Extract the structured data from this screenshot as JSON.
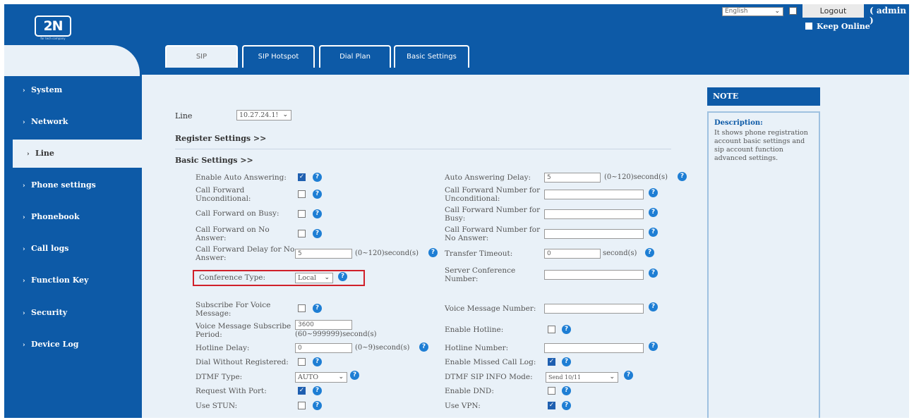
{
  "header": {
    "logo_text": "2N",
    "logo_sub": "for tech company",
    "language": "English",
    "logout_label": "Logout",
    "admin_label": "( admin )",
    "keep_online_label": "Keep Online",
    "keep_online_checked": true
  },
  "tabs": [
    {
      "label": "SIP",
      "active": true
    },
    {
      "label": "SIP Hotspot",
      "active": false
    },
    {
      "label": "Dial Plan",
      "active": false
    },
    {
      "label": "Basic Settings",
      "active": false
    }
  ],
  "sidebar": {
    "items": [
      {
        "label": "System",
        "active": false
      },
      {
        "label": "Network",
        "active": false
      },
      {
        "label": "Line",
        "active": true
      },
      {
        "label": "Phone settings",
        "active": false
      },
      {
        "label": "Phonebook",
        "active": false
      },
      {
        "label": "Call logs",
        "active": false
      },
      {
        "label": "Function Key",
        "active": false
      },
      {
        "label": "Security",
        "active": false
      },
      {
        "label": "Device Log",
        "active": false
      }
    ]
  },
  "note": {
    "header": "NOTE",
    "title": "Description:",
    "text": "It shows phone registration account basic settings and sip account function advanced settings."
  },
  "line": {
    "label": "Line",
    "value": "10.27.24.1!"
  },
  "sections": {
    "register": "Register Settings >>",
    "basic": "Basic Settings >>"
  },
  "settings": {
    "enable_auto_answering": {
      "label": "Enable Auto Answering:",
      "checked": true
    },
    "auto_answering_delay": {
      "label": "Auto Answering Delay:",
      "value": "5",
      "hint": "(0~120)second(s)"
    },
    "cf_unconditional": {
      "label1": "Call Forward",
      "label2": "Unconditional:",
      "checked": false
    },
    "cf_number_unconditional": {
      "label1": "Call Forward Number for",
      "label2": "Unconditional:",
      "value": ""
    },
    "cf_busy": {
      "label": "Call Forward on Busy:",
      "checked": false
    },
    "cf_number_busy": {
      "label1": "Call Forward Number for",
      "label2": "Busy:",
      "value": ""
    },
    "cf_no_answer": {
      "label1": "Call Forward on No",
      "label2": "Answer:",
      "checked": false
    },
    "cf_number_no_answer": {
      "label1": "Call Forward Number for",
      "label2": "No Answer:",
      "value": ""
    },
    "cf_delay": {
      "label1": "Call Forward Delay for No",
      "label2": "Answer:",
      "value": "5",
      "hint": "(0~120)second(s)"
    },
    "transfer_timeout": {
      "label": "Transfer Timeout:",
      "value": "0",
      "hint": "second(s)"
    },
    "conference_type": {
      "label": "Conference Type:",
      "value": "Local"
    },
    "server_conference_number": {
      "label1": "Server Conference",
      "label2": "Number:",
      "value": ""
    },
    "subscribe_voice": {
      "label1": "Subscribe For Voice",
      "label2": "Message:",
      "checked": false
    },
    "voice_message_number": {
      "label": "Voice Message Number:",
      "value": ""
    },
    "vm_subscribe_period": {
      "label1": "Voice Message Subscribe",
      "label2": "Period:",
      "value": "3600",
      "hint": "(60~999999)second(s)"
    },
    "enable_hotline": {
      "label": "Enable Hotline:",
      "checked": false
    },
    "hotline_delay": {
      "label": "Hotline Delay:",
      "value": "0",
      "hint": "(0~9)second(s)"
    },
    "hotline_number": {
      "label": "Hotline Number:",
      "value": ""
    },
    "dial_without_registered": {
      "label": "Dial Without Registered:",
      "checked": false
    },
    "enable_missed_call_log": {
      "label": "Enable Missed Call Log:",
      "checked": true
    },
    "dtmf_type": {
      "label": "DTMF Type:",
      "value": "AUTO"
    },
    "dtmf_sip_info_mode": {
      "label": "DTMF SIP INFO Mode:",
      "value": "Send 10/11"
    },
    "request_with_port": {
      "label": "Request With Port:",
      "checked": true
    },
    "enable_dnd": {
      "label": "Enable DND:",
      "checked": false
    },
    "use_stun": {
      "label": "Use STUN:",
      "checked": false
    },
    "use_vpn": {
      "label": "Use VPN:",
      "checked": true
    }
  },
  "icons": {
    "help": "?",
    "check": "✓",
    "chevron": "⌄",
    "arrow": "›"
  },
  "colors": {
    "brand_blue": "#0d5aa7",
    "content_bg": "#e9f1f8",
    "help_blue": "#1e7ed4",
    "highlight_red": "#d0202a"
  }
}
